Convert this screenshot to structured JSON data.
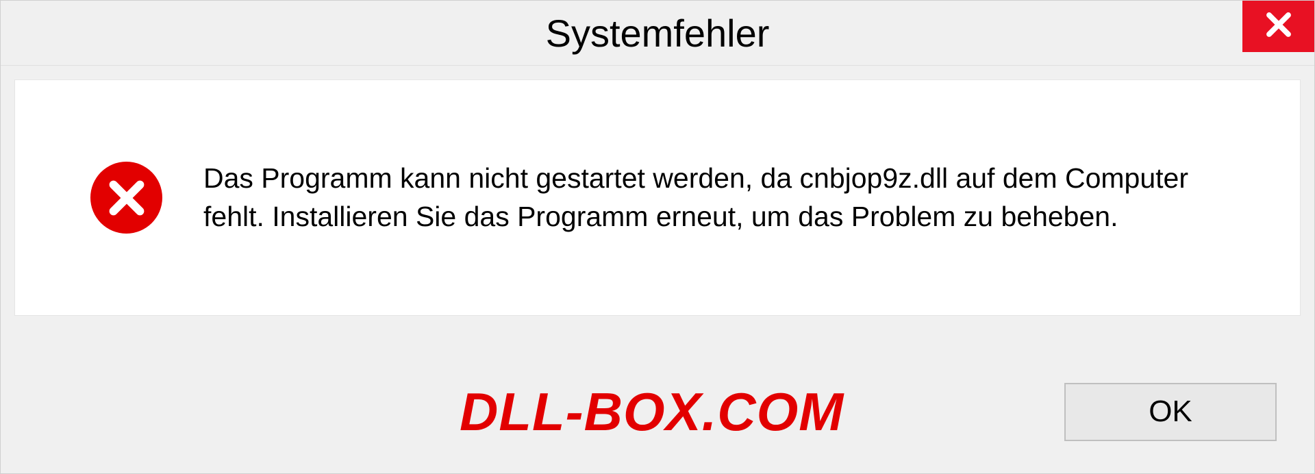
{
  "title": "Systemfehler",
  "message": "Das Programm kann nicht gestartet werden, da cnbjop9z.dll auf dem Computer fehlt. Installieren Sie das Programm erneut, um das Problem zu beheben.",
  "watermark": "DLL-BOX.COM",
  "ok_label": "OK"
}
